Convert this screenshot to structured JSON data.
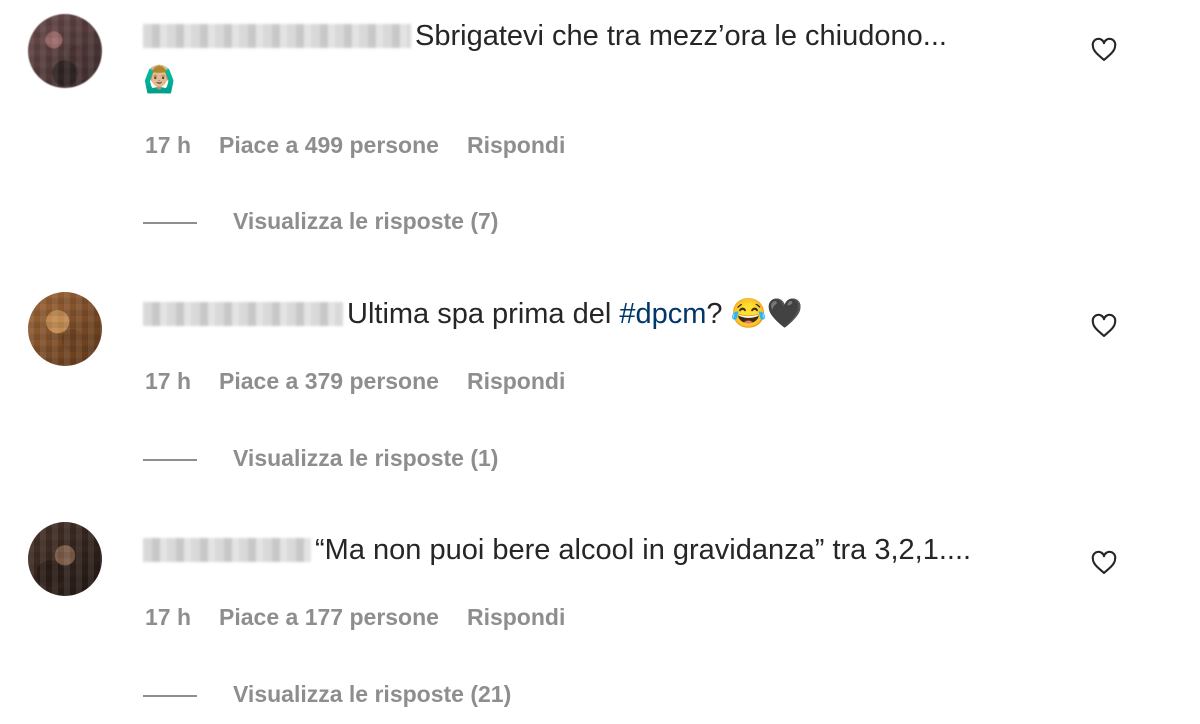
{
  "comments": [
    {
      "text": "Sbrigatevi che tra mezz’ora le chiudono...",
      "emoji_line": "🙆🏼‍♂️",
      "time": "17 h",
      "likes": "Piace a 499 persone",
      "reply_label": "Rispondi",
      "replies_label": "Visualizza le risposte (7)"
    },
    {
      "text_before": "Ultima spa prima del ",
      "hashtag": "#dpcm",
      "text_after": "? 😂🖤",
      "time": "17 h",
      "likes": "Piace a 379 persone",
      "reply_label": "Rispondi",
      "replies_label": "Visualizza le risposte (1)"
    },
    {
      "text": "“Ma non puoi bere alcool in gravidanza” tra 3,2,1....",
      "time": "17 h",
      "likes": "Piace a 177 persone",
      "reply_label": "Rispondi",
      "replies_label": "Visualizza le risposte (21)"
    }
  ],
  "icons": {
    "like": "heart-outline-icon",
    "avatar": "user-avatar"
  },
  "colors": {
    "text": "#262626",
    "meta": "#8e8e8e",
    "hashtag": "#00376b"
  }
}
